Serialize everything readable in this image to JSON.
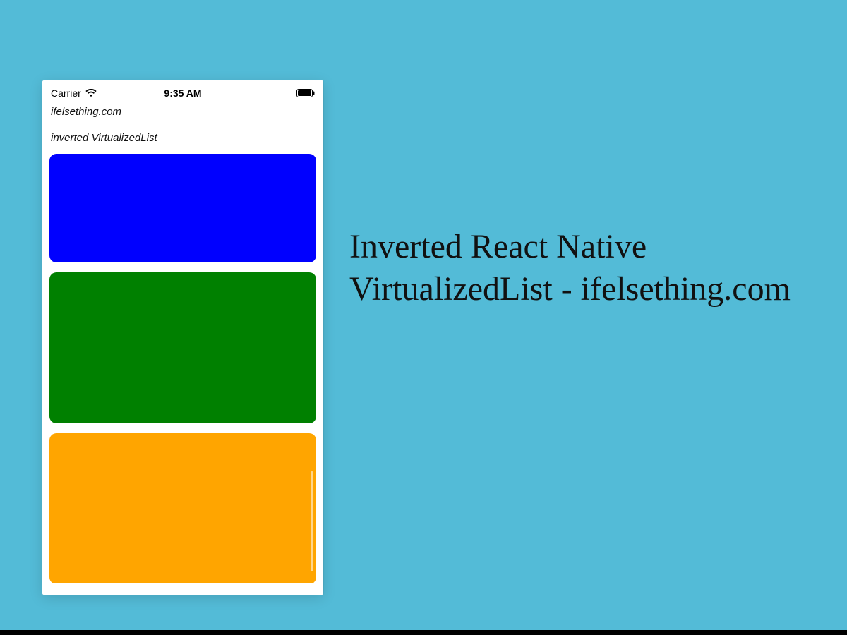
{
  "colors": {
    "background": "#53bbd7",
    "blue": "#0000ff",
    "green": "#008000",
    "orange": "#ffa500"
  },
  "statusBar": {
    "carrier": "Carrier",
    "time": "9:35 AM"
  },
  "app": {
    "site": "ifelsething.com",
    "subtitle": "inverted VirtualizedList"
  },
  "list": {
    "items": [
      {
        "colorKey": "blue"
      },
      {
        "colorKey": "green"
      },
      {
        "colorKey": "orange"
      }
    ]
  },
  "headline": {
    "text": "Inverted React Native VirtualizedList - ifelsething.com"
  }
}
